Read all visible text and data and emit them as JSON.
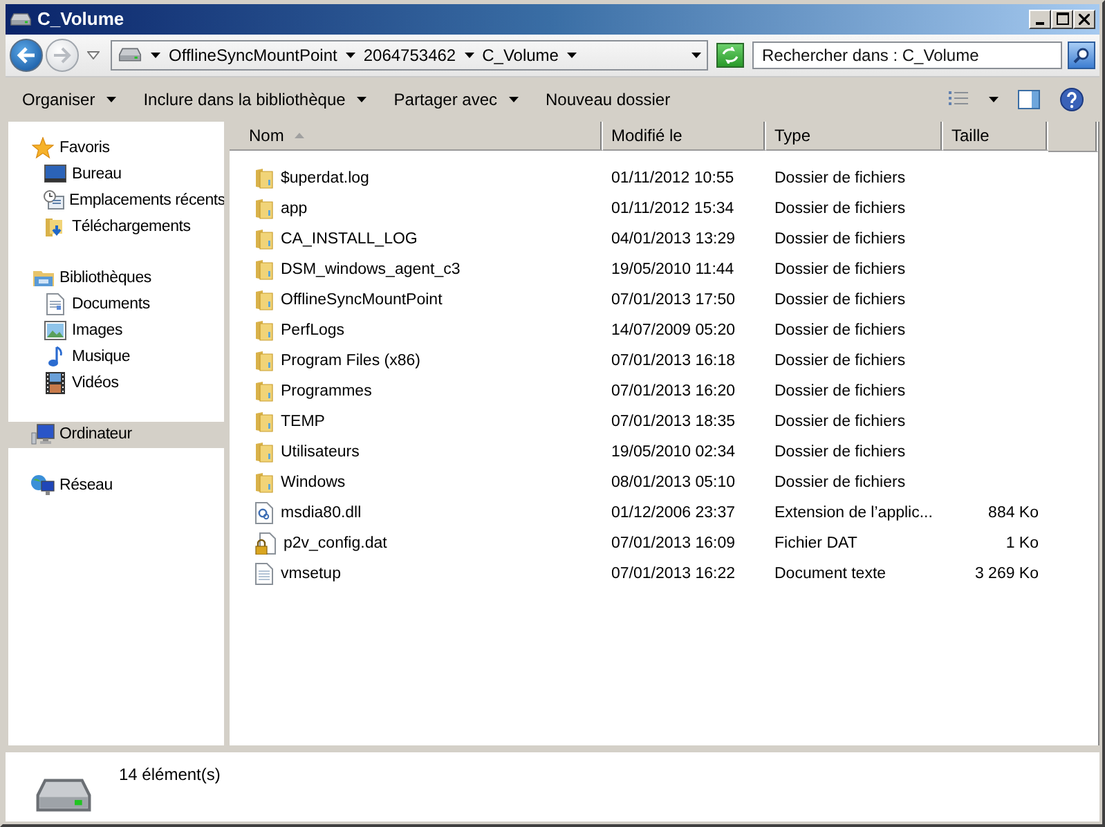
{
  "window": {
    "title": "C_Volume"
  },
  "address_bar": {
    "breadcrumbs": [
      "OfflineSyncMountPoint",
      "2064753462",
      "C_Volume"
    ]
  },
  "search": {
    "placeholder": "Rechercher dans : C_Volume"
  },
  "toolbar": {
    "buttons": [
      {
        "label": "Organiser",
        "dropdown": true
      },
      {
        "label": "Inclure dans la bibliothèque",
        "dropdown": true
      },
      {
        "label": "Partager avec",
        "dropdown": true
      },
      {
        "label": "Nouveau dossier",
        "dropdown": false
      }
    ]
  },
  "navigation": [
    {
      "label": "Favoris",
      "selected": false,
      "children": [
        {
          "label": "Bureau",
          "selected": false
        },
        {
          "label": "Emplacements récents",
          "selected": false
        },
        {
          "label": "Téléchargements",
          "selected": false
        }
      ]
    },
    {
      "label": "Bibliothèques",
      "selected": false,
      "children": [
        {
          "label": "Documents",
          "selected": false
        },
        {
          "label": "Images",
          "selected": false
        },
        {
          "label": "Musique",
          "selected": false
        },
        {
          "label": "Vidéos",
          "selected": false
        }
      ]
    },
    {
      "label": "Ordinateur",
      "selected": true
    },
    {
      "label": "Réseau",
      "selected": false
    }
  ],
  "table": {
    "columns": [
      {
        "label": "Nom",
        "sorted": true
      },
      {
        "label": "Modifié le",
        "sorted": false
      },
      {
        "label": "Type",
        "sorted": false
      },
      {
        "label": "Taille",
        "sorted": false
      }
    ],
    "rows": [
      {
        "kind": "folder",
        "name": "$uperdat.log",
        "modified": "01/11/2012 10:55",
        "type": "Dossier de fichiers"
      },
      {
        "kind": "folder",
        "name": "app",
        "modified": "01/11/2012 15:34",
        "type": "Dossier de fichiers"
      },
      {
        "kind": "folder",
        "name": "CA_INSTALL_LOG",
        "modified": "04/01/2013 13:29",
        "type": "Dossier de fichiers"
      },
      {
        "kind": "folder",
        "name": "DSM_windows_agent_c3",
        "modified": "19/05/2010 11:44",
        "type": "Dossier de fichiers"
      },
      {
        "kind": "folder",
        "name": "OfflineSyncMountPoint",
        "modified": "07/01/2013 17:50",
        "type": "Dossier de fichiers"
      },
      {
        "kind": "folder",
        "name": "PerfLogs",
        "modified": "14/07/2009 05:20",
        "type": "Dossier de fichiers"
      },
      {
        "kind": "folder",
        "name": "Program Files (x86)",
        "modified": "07/01/2013 16:18",
        "type": "Dossier de fichiers"
      },
      {
        "kind": "folder",
        "name": "Programmes",
        "modified": "07/01/2013 16:20",
        "type": "Dossier de fichiers"
      },
      {
        "kind": "folder",
        "name": "TEMP",
        "modified": "07/01/2013 18:35",
        "type": "Dossier de fichiers"
      },
      {
        "kind": "folder",
        "name": "Utilisateurs",
        "modified": "19/05/2010 02:34",
        "type": "Dossier de fichiers"
      },
      {
        "kind": "folder",
        "name": "Windows",
        "modified": "08/01/2013 05:10",
        "type": "Dossier de fichiers"
      },
      {
        "kind": "library",
        "name": "msdia80.dll",
        "modified": "01/12/2006 23:37",
        "type": "Extension de l’applic...",
        "size": "884 Ko"
      },
      {
        "kind": "locked",
        "name": "p2v_config.dat",
        "modified": "07/01/2013 16:09",
        "type": "Fichier DAT",
        "size": "1 Ko"
      },
      {
        "kind": "text",
        "name": "vmsetup",
        "modified": "07/01/2013 16:22",
        "type": "Document texte",
        "size": "3 269 Ko"
      }
    ]
  },
  "status_bar": {
    "count": "14 élément(s)"
  }
}
